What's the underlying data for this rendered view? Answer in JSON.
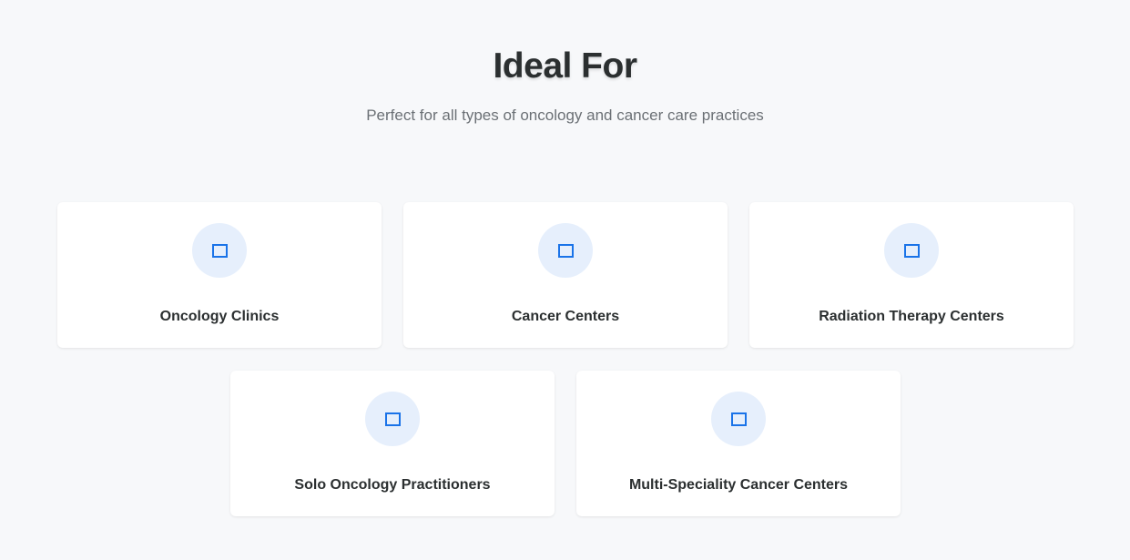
{
  "section": {
    "title": "Ideal For",
    "subtitle": "Perfect for all types of oncology and cancer care practices"
  },
  "cards": [
    {
      "icon": "square-icon",
      "label": "Oncology Clinics"
    },
    {
      "icon": "square-icon",
      "label": "Cancer Centers"
    },
    {
      "icon": "square-icon",
      "label": "Radiation Therapy Centers"
    },
    {
      "icon": "square-icon",
      "label": "Solo Oncology Practitioners"
    },
    {
      "icon": "square-icon",
      "label": "Multi-Speciality Cancer Centers"
    }
  ],
  "colors": {
    "background": "#f7f8fa",
    "heading": "#2b2f30",
    "subtitle": "#6b7075",
    "icon_accent": "#1a73e8",
    "icon_circle": "#e6effc",
    "card": "#ffffff"
  }
}
